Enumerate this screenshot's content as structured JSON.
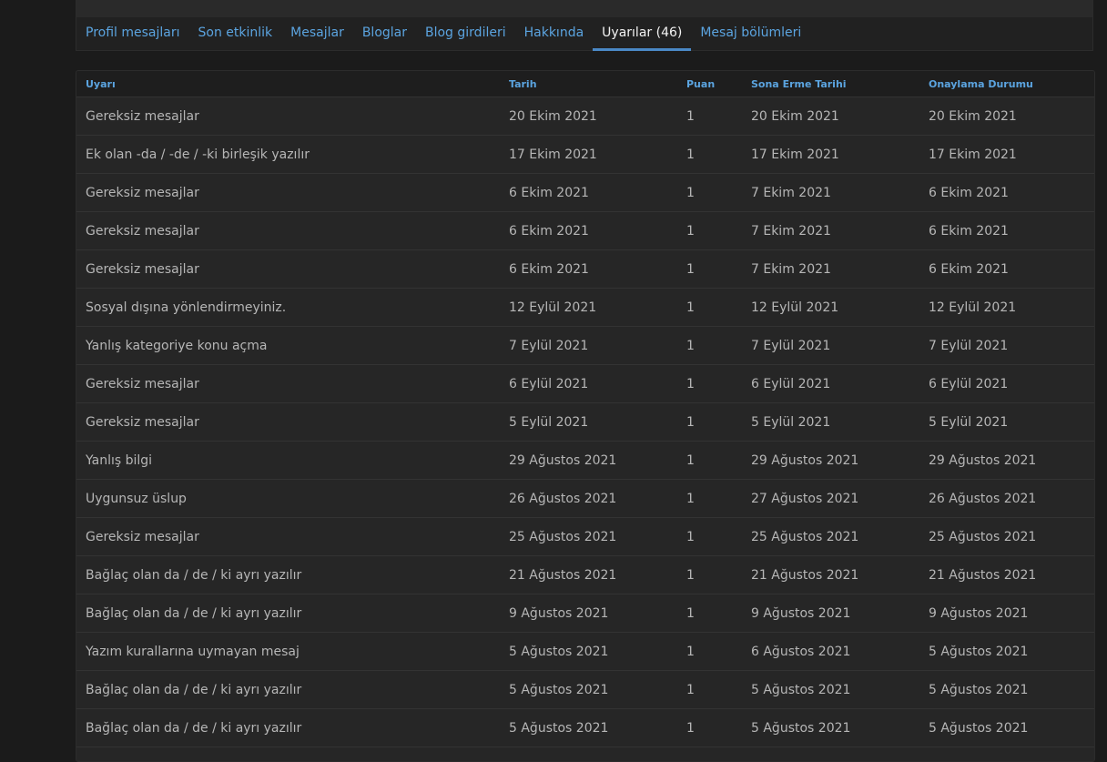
{
  "tabs": [
    {
      "label": "Profil mesajları"
    },
    {
      "label": "Son etkinlik"
    },
    {
      "label": "Mesajlar"
    },
    {
      "label": "Bloglar"
    },
    {
      "label": "Blog girdileri"
    },
    {
      "label": "Hakkında"
    },
    {
      "label": "Uyarılar (46)"
    },
    {
      "label": "Mesaj bölümleri"
    }
  ],
  "active_tab": "Uyarılar (46)",
  "table": {
    "headers": [
      "Uyarı",
      "Tarih",
      "Puan",
      "Sona Erme Tarihi",
      "Onaylama Durumu"
    ],
    "rows": [
      [
        "Gereksiz mesajlar",
        "20 Ekim 2021",
        "1",
        "20 Ekim 2021",
        "20 Ekim 2021"
      ],
      [
        "Ek olan -da / -de / -ki birleşik yazılır",
        "17 Ekim 2021",
        "1",
        "17 Ekim 2021",
        "17 Ekim 2021"
      ],
      [
        "Gereksiz mesajlar",
        "6 Ekim 2021",
        "1",
        "7 Ekim 2021",
        "6 Ekim 2021"
      ],
      [
        "Gereksiz mesajlar",
        "6 Ekim 2021",
        "1",
        "7 Ekim 2021",
        "6 Ekim 2021"
      ],
      [
        "Gereksiz mesajlar",
        "6 Ekim 2021",
        "1",
        "7 Ekim 2021",
        "6 Ekim 2021"
      ],
      [
        "Sosyal dışına yönlendirmeyiniz.",
        "12 Eylül 2021",
        "1",
        "12 Eylül 2021",
        "12 Eylül 2021"
      ],
      [
        "Yanlış kategoriye konu açma",
        "7 Eylül 2021",
        "1",
        "7 Eylül 2021",
        "7 Eylül 2021"
      ],
      [
        "Gereksiz mesajlar",
        "6 Eylül 2021",
        "1",
        "6 Eylül 2021",
        "6 Eylül 2021"
      ],
      [
        "Gereksiz mesajlar",
        "5 Eylül 2021",
        "1",
        "5 Eylül 2021",
        "5 Eylül 2021"
      ],
      [
        "Yanlış bilgi",
        "29 Ağustos 2021",
        "1",
        "29 Ağustos 2021",
        "29 Ağustos 2021"
      ],
      [
        "Uygunsuz üslup",
        "26 Ağustos 2021",
        "1",
        "27 Ağustos 2021",
        "26 Ağustos 2021"
      ],
      [
        "Gereksiz mesajlar",
        "25 Ağustos 2021",
        "1",
        "25 Ağustos 2021",
        "25 Ağustos 2021"
      ],
      [
        "Bağlaç olan da / de / ki ayrı yazılır",
        "21 Ağustos 2021",
        "1",
        "21 Ağustos 2021",
        "21 Ağustos 2021"
      ],
      [
        "Bağlaç olan da / de / ki ayrı yazılır",
        "9 Ağustos 2021",
        "1",
        "9 Ağustos 2021",
        "9 Ağustos 2021"
      ],
      [
        "Yazım kurallarına uymayan mesaj",
        "5 Ağustos 2021",
        "1",
        "6 Ağustos 2021",
        "5 Ağustos 2021"
      ],
      [
        "Bağlaç olan da / de / ki ayrı yazılır",
        "5 Ağustos 2021",
        "1",
        "5 Ağustos 2021",
        "5 Ağustos 2021"
      ],
      [
        "Bağlaç olan da / de / ki ayrı yazılır",
        "5 Ağustos 2021",
        "1",
        "5 Ağustos 2021",
        "5 Ağustos 2021"
      ],
      [
        "",
        "",
        "",
        "",
        ""
      ]
    ]
  },
  "colors": {
    "background": "#1b1b1b",
    "link": "#5ba4e0",
    "active_tab_text": "#f2f2f2",
    "active_tab_underline": "#4a88c6",
    "cell_text": "#b6b6b6",
    "row_background": "#262626"
  }
}
